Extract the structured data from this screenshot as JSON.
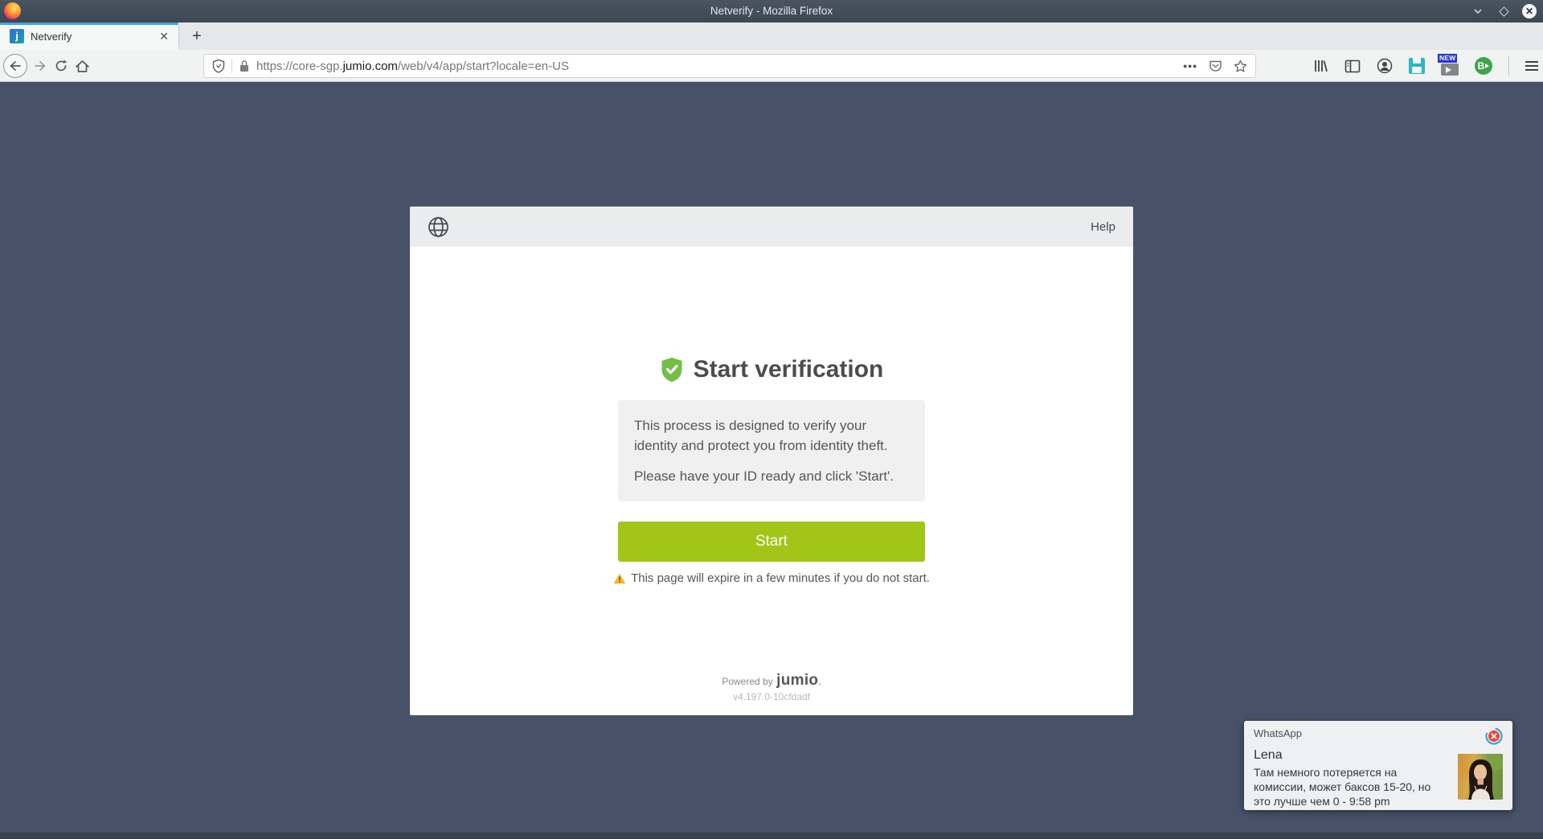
{
  "window": {
    "title": "Netverify - Mozilla Firefox"
  },
  "tab_bar": {
    "tab": {
      "label": "Netverify",
      "favicon_letter": "j",
      "close_glyph": "✕"
    },
    "new_tab_glyph": "+"
  },
  "nav": {
    "url_prefix": "https://core-sgp.",
    "url_domain": "jumio.com",
    "url_path": "/web/v4/app/start?locale=en-US",
    "page_actions_glyph": "•••",
    "new_badge": "NEW",
    "extension_letter": "B"
  },
  "card": {
    "help_label": "Help",
    "heading": "Start verification",
    "info_line1": "This process is designed to verify your identity and protect you from identity theft.",
    "info_line2": "Please have your ID ready and click 'Start'.",
    "start_button_label": "Start",
    "expiry_warning": "This page will expire in a few minutes if you do not start.",
    "footer": {
      "powered_by": "Powered by",
      "brand": "jumio",
      "brand_suffix": ".",
      "version": "v4.197.0-10cfdadf"
    }
  },
  "notification": {
    "app_name": "WhatsApp",
    "sender": "Lena",
    "message": "Там немного потеряется на комиссии, может баксов 15-20, но это лучше чем 0 - 9:58 pm"
  },
  "colors": {
    "page_background": "#475168",
    "accent_green": "#a2c617",
    "shield_green": "#71bf44",
    "tab_accent_blue": "#42a5dc",
    "warning_yellow": "#fcb622"
  }
}
